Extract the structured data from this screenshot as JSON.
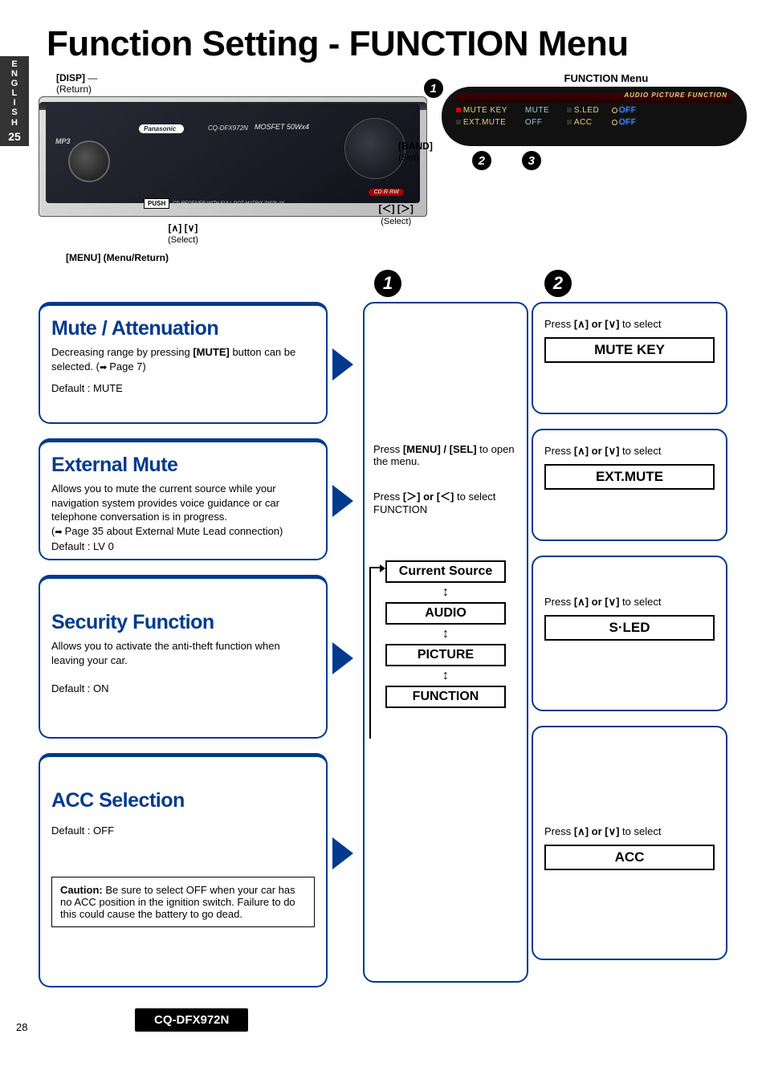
{
  "language_tab": {
    "letters": "ENGLISH",
    "number": "25"
  },
  "page_title": "Function Setting - FUNCTION Menu",
  "radio_panel": {
    "disp_label": "[DISP]",
    "disp_sub": "(Return)",
    "brand": "Panasonic",
    "model_small": "CQ-DFX972N",
    "mosfet": "MOSFET 50Wx4",
    "mp3": "MP3",
    "push": "PUSH",
    "cdtext": "CD RECEIVER WITH FULL DOT MATRIX DISPLAY",
    "cdrrw": "CD·R·RW",
    "band_label": "[BAND]",
    "band_sub": "(Set)",
    "updown_label": "[∧] [∨]",
    "updown_sub": "(Select)",
    "leftright_label": "[＜] [＞]",
    "leftright_sub": "(Select)",
    "menu_label": "[MENU] (Menu/Return)"
  },
  "function_menu": {
    "title": "FUNCTION Menu",
    "topbar_labels": "AUDIO PICTURE  FUNCTION",
    "row1": {
      "left": "MUTE KEY",
      "mid": "MUTE",
      "r1": "S.LED",
      "r2": "OFF"
    },
    "row2": {
      "left": "EXT.MUTE",
      "mid": "OFF",
      "r1": "ACC",
      "r2": "OFF"
    }
  },
  "steps": {
    "s1": "1",
    "s2": "2",
    "s3": "3"
  },
  "left_boxes": {
    "mute": {
      "heading": "Mute / Attenuation",
      "desc_a": "Decreasing range by pressing ",
      "desc_bold": "[MUTE]",
      "desc_b": " button can be selected. (",
      "pageref": "Page 7",
      "desc_c": ")",
      "default": "Default : MUTE"
    },
    "extmute": {
      "heading": "External Mute",
      "desc": "Allows you to mute the current source while your navigation system provides voice guidance or car telephone conversation is in progress.",
      "pageref": "Page 35 about External Mute Lead connection",
      "default": "Default : LV  0"
    },
    "security": {
      "heading": "Security Function",
      "desc": "Allows you to activate the anti-theft function when leaving your car.",
      "default": "Default : ON"
    },
    "acc": {
      "heading": "ACC Selection",
      "default": "Default : OFF",
      "caution_label": "Caution:",
      "caution": " Be sure to select OFF when your car has no ACC position in the ignition switch. Failure to do this could cause the battery to go dead."
    }
  },
  "mid_box": {
    "step1a": "Press ",
    "step1_bold": "[MENU] / [SEL]",
    "step1b": " to open the menu.",
    "step2a": "Press  ",
    "step2_lr": "[＞] or [＜]",
    "step2b": " to select FUNCTION",
    "items": [
      "Current Source",
      "AUDIO",
      "PICTURE",
      "FUNCTION"
    ]
  },
  "right_boxes": {
    "select_prefix": "Press ",
    "select_ud": "[∧] or [∨]",
    "select_suffix": " to select",
    "targets": [
      "MUTE KEY",
      "EXT.MUTE",
      "S·LED",
      "ACC"
    ]
  },
  "footer": {
    "page_number": "28",
    "model": "CQ-DFX972N"
  }
}
